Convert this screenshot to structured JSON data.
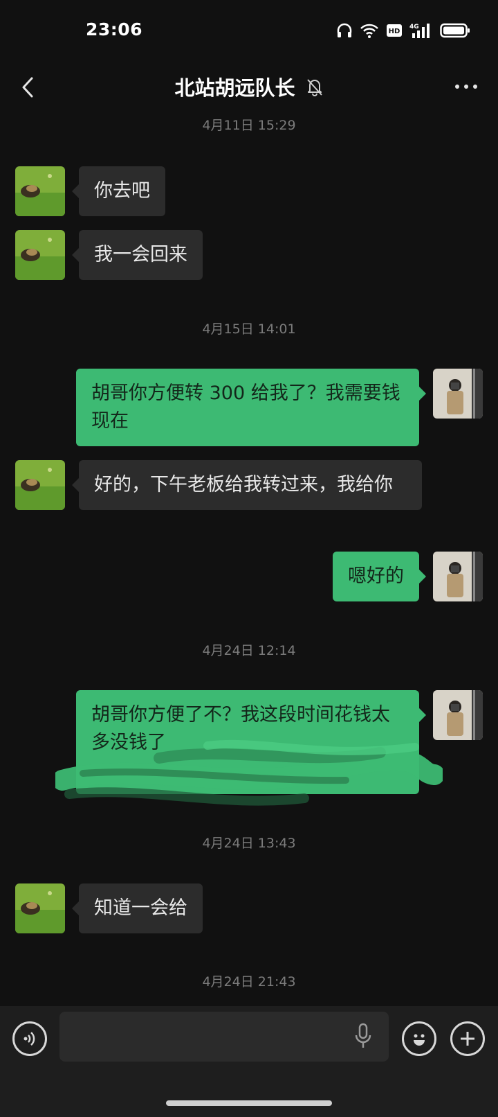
{
  "status_bar": {
    "time": "23:06",
    "network_label": "HD",
    "cell_label": "4G"
  },
  "header": {
    "title": "北站胡远队长"
  },
  "messages": [
    {
      "type": "timestamp",
      "text": "4月11日 15:29"
    },
    {
      "type": "message",
      "sender": "other",
      "text": "你去吧"
    },
    {
      "type": "message",
      "sender": "other",
      "text": "我一会回来"
    },
    {
      "type": "timestamp",
      "text": "4月15日 14:01"
    },
    {
      "type": "message",
      "sender": "me",
      "text": "胡哥你方便转 300 给我了？我需要钱现在"
    },
    {
      "type": "message",
      "sender": "other",
      "text": "好的，下午老板给我转过来，我给你"
    },
    {
      "type": "message",
      "sender": "me",
      "text": "嗯好的"
    },
    {
      "type": "timestamp",
      "text": "4月24日 12:14"
    },
    {
      "type": "message",
      "sender": "me",
      "text": "胡哥你方便了不？我这段时间花钱太多没钱了",
      "partially_redacted": true
    },
    {
      "type": "timestamp",
      "text": "4月24日 13:43"
    },
    {
      "type": "message",
      "sender": "other",
      "text": "知道一会给"
    },
    {
      "type": "timestamp",
      "text": "4月24日 21:43"
    }
  ],
  "colors": {
    "background": "#111111",
    "my_bubble": "#3dba73",
    "their_bubble": "#2c2c2c",
    "timestamp": "#7c7c7c"
  },
  "icons": {
    "back": "chevron-left-icon",
    "mute": "bell-off-icon",
    "more": "more-dots-icon",
    "voice": "voice-icon",
    "mic": "microphone-icon",
    "emoji": "emoji-icon",
    "plus": "plus-icon"
  },
  "input": {
    "placeholder": ""
  }
}
